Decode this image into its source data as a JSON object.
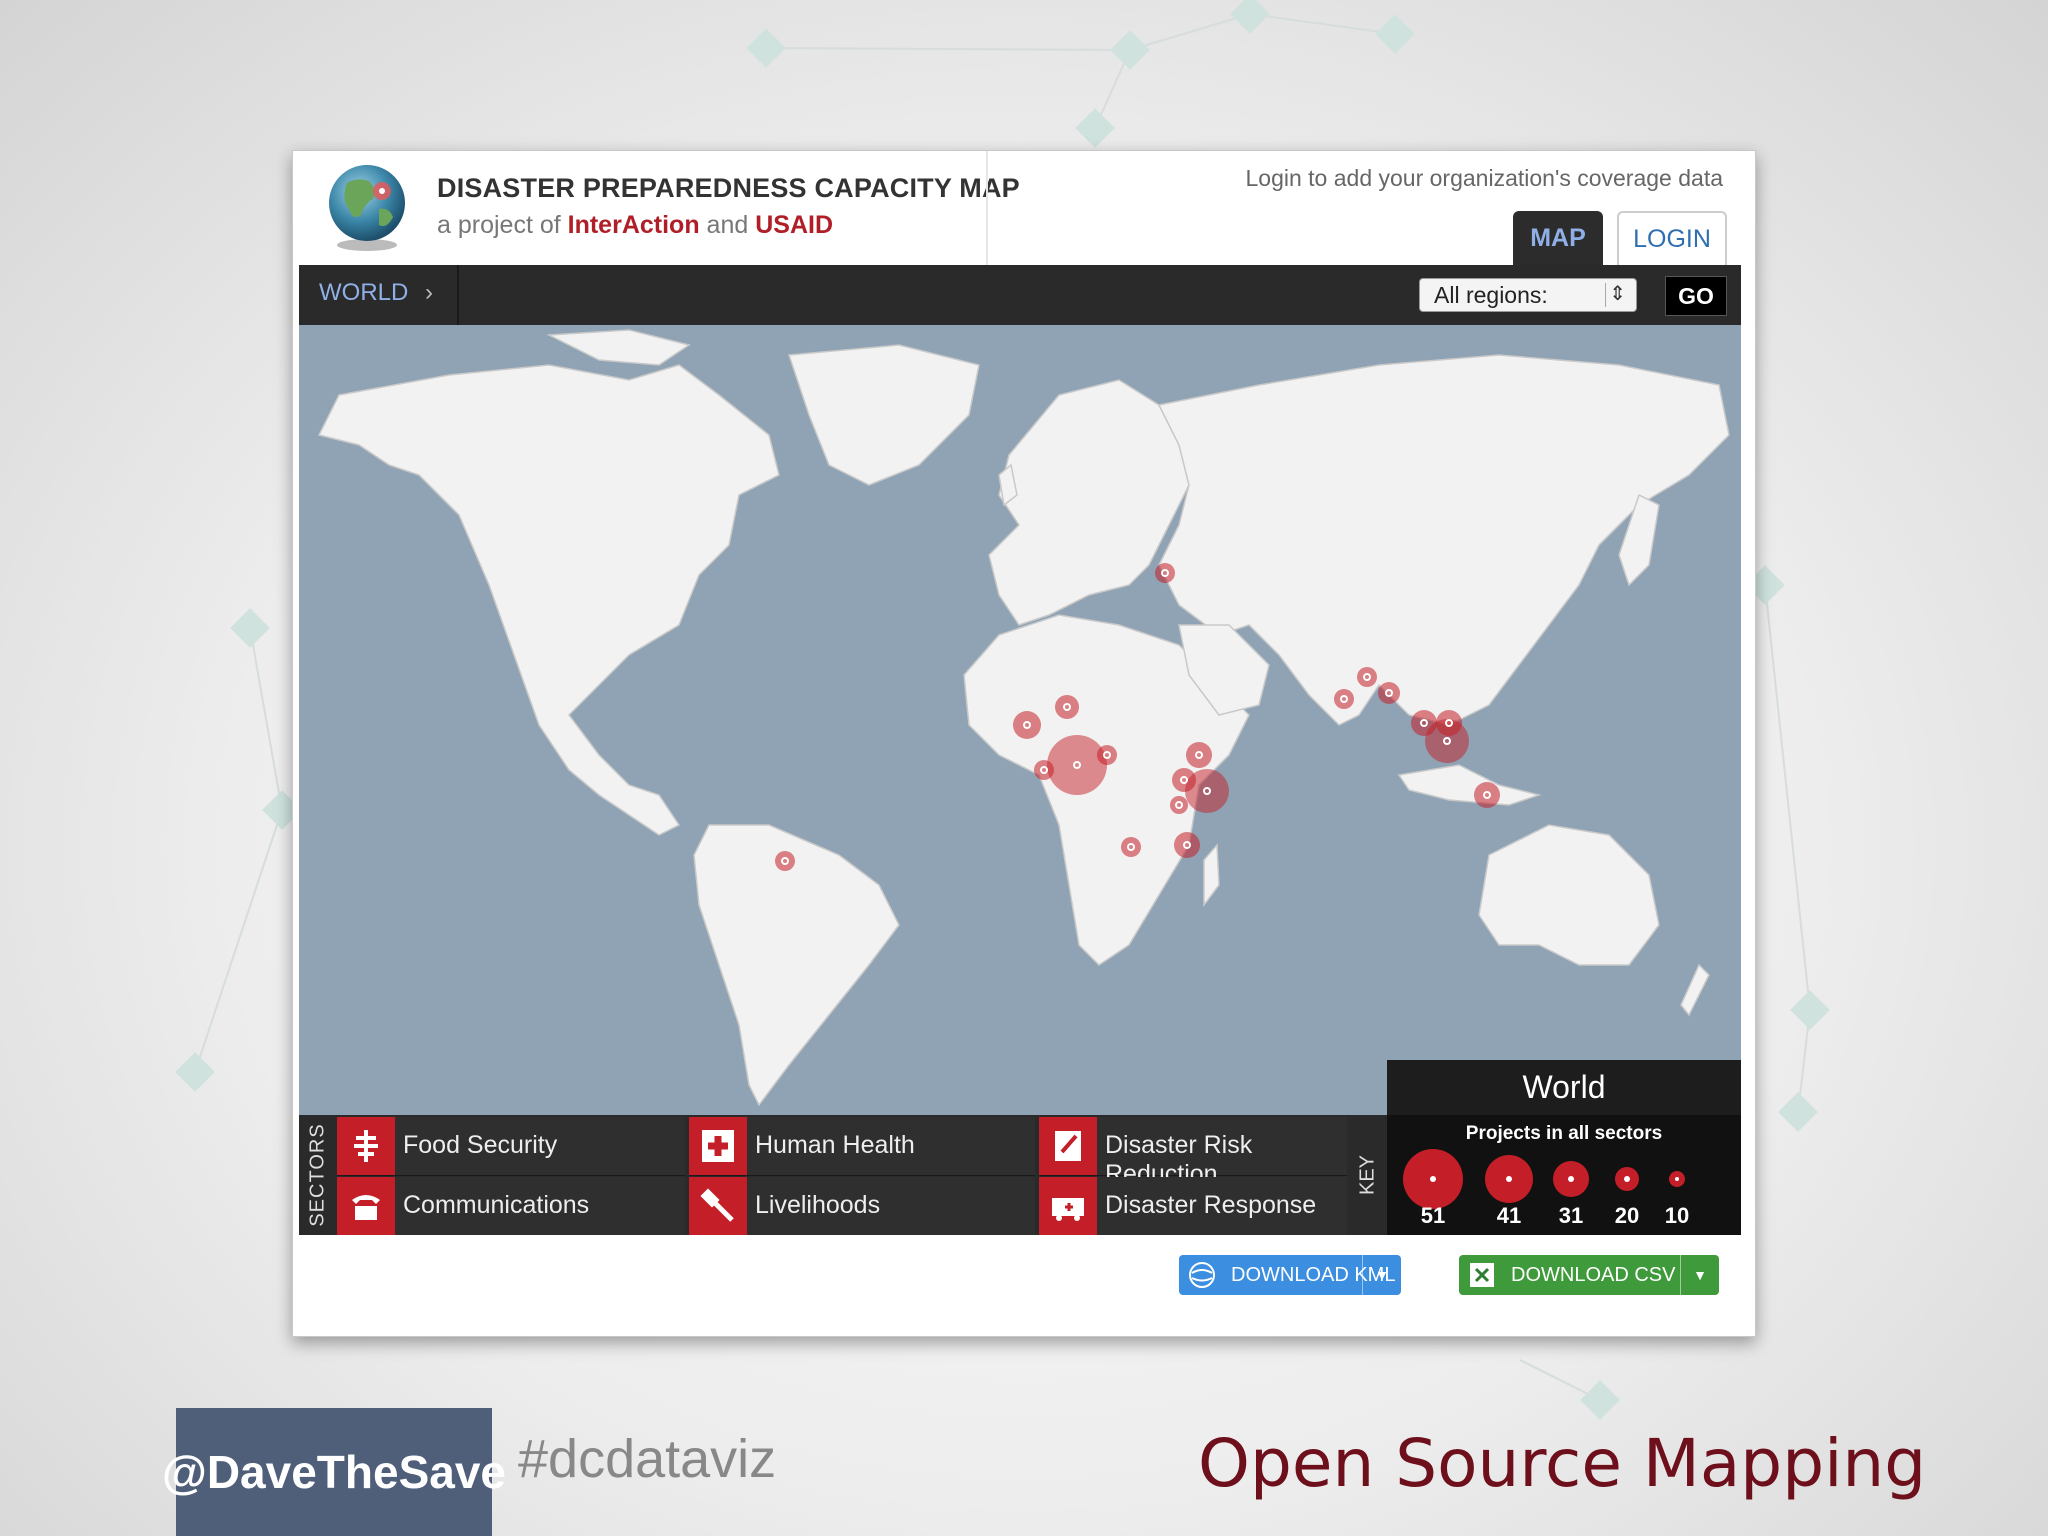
{
  "header": {
    "title": "DISASTER PREPAREDNESS CAPACITY MAP",
    "subtitle_prefix": "a project of",
    "org1": "InterAction",
    "subtitle_and": "and",
    "org2": "USAID",
    "login_hint": "Login to add your organization's coverage data"
  },
  "tabs": {
    "map": "MAP",
    "login": "LOGIN"
  },
  "nav": {
    "breadcrumb": "WORLD",
    "region_select": "All regions:",
    "go_label": "GO"
  },
  "map": {
    "region_label": "World"
  },
  "sectors": {
    "label": "SECTORS",
    "items": [
      {
        "label": "Food Security",
        "icon": "food-security-icon"
      },
      {
        "label": "Human Health",
        "icon": "human-health-icon"
      },
      {
        "label": "Disaster Risk Reduction",
        "icon": "disaster-risk-reduction-icon"
      },
      {
        "label": "Communications",
        "icon": "communications-icon"
      },
      {
        "label": "Livelihoods",
        "icon": "livelihoods-icon"
      },
      {
        "label": "Disaster Response",
        "icon": "disaster-response-icon"
      }
    ]
  },
  "key": {
    "label": "KEY",
    "title": "Projects in all sectors",
    "values": [
      "51",
      "41",
      "31",
      "20",
      "10"
    ]
  },
  "downloads": {
    "kml": "DOWNLOAD KML",
    "csv": "DOWNLOAD CSV"
  },
  "slide": {
    "handle": "@DaveTheSave",
    "hashtag": "#dcdataviz",
    "title": "Open Source Mapping"
  },
  "colors": {
    "marker": "#c41f28",
    "ocean": "#8fa3b4",
    "land": "#f2f2f2",
    "slide_title": "#6e0f1c",
    "handle_bg": "#4f5f79"
  }
}
